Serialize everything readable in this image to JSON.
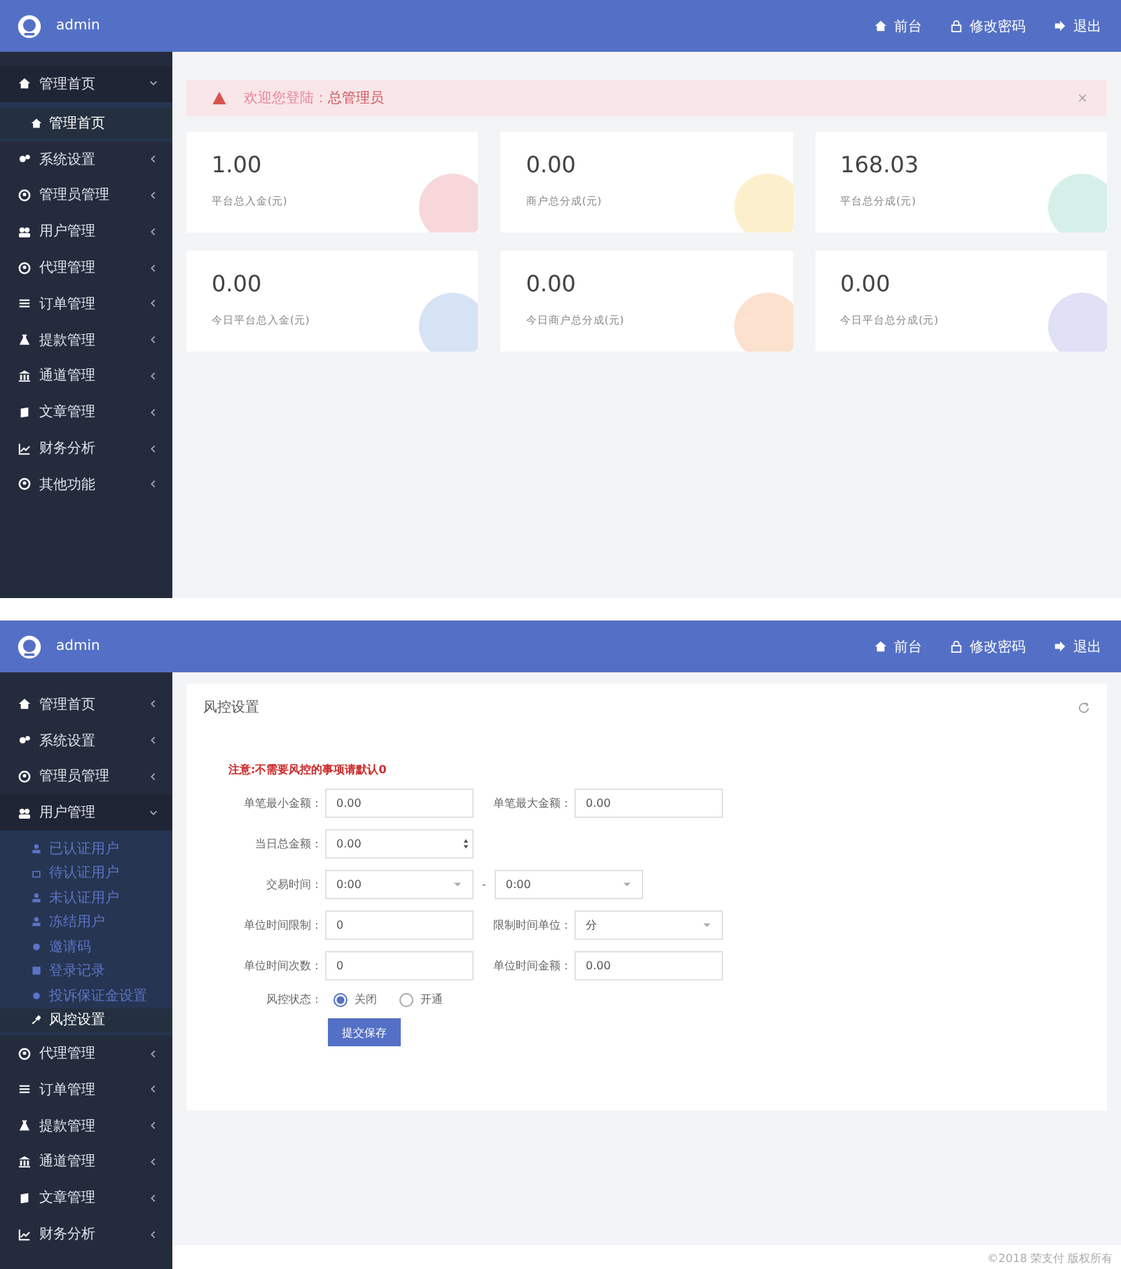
{
  "screens": [
    {
      "header": {
        "user": "admin",
        "links": [
          {
            "label": "前台"
          },
          {
            "label": "修改密码"
          },
          {
            "label": "退出"
          }
        ]
      },
      "sidebar": {
        "items": [
          {
            "label": "管理首页",
            "expanded": true,
            "children": [
              {
                "label": "管理首页",
                "selected": true
              }
            ]
          },
          {
            "label": "系统设置",
            "expanded": false
          },
          {
            "label": "管理员管理",
            "expanded": false
          },
          {
            "label": "用户管理",
            "expanded": false
          },
          {
            "label": "代理管理",
            "expanded": false
          },
          {
            "label": "订单管理",
            "expanded": false
          },
          {
            "label": "提款管理",
            "expanded": false
          },
          {
            "label": "通道管理",
            "expanded": false
          },
          {
            "label": "文章管理",
            "expanded": false
          },
          {
            "label": "财务分析",
            "expanded": false
          },
          {
            "label": "其他功能",
            "expanded": false
          }
        ]
      },
      "main": {
        "kind": "dashboard",
        "alert": {
          "text": "欢迎您登陆：",
          "role": "总管理员",
          "close": "×"
        },
        "stats": [
          {
            "value": "1.00",
            "label": "平台总入金(元)",
            "color": "#f7d7da"
          },
          {
            "value": "0.00",
            "label": "商户总分成(元)",
            "color": "#fcf0cc"
          },
          {
            "value": "168.03",
            "label": "平台总分成(元)",
            "color": "#d6f0e9"
          },
          {
            "value": "0.00",
            "label": "今日平台总入金(元)",
            "color": "#d6e3f5"
          },
          {
            "value": "0.00",
            "label": "今日商户总分成(元)",
            "color": "#fbe1ce"
          },
          {
            "value": "0.00",
            "label": "今日平台总分成(元)",
            "color": "#e0e0f6"
          }
        ]
      }
    },
    {
      "header": {
        "user": "admin",
        "links": [
          {
            "label": "前台"
          },
          {
            "label": "修改密码"
          },
          {
            "label": "退出"
          }
        ]
      },
      "sidebar": {
        "items": [
          {
            "label": "管理首页",
            "expanded": false
          },
          {
            "label": "系统设置",
            "expanded": false
          },
          {
            "label": "管理员管理",
            "expanded": false
          },
          {
            "label": "用户管理",
            "expanded": true,
            "children": [
              {
                "label": "已认证用户",
                "selected": false
              },
              {
                "label": "待认证用户",
                "selected": false
              },
              {
                "label": "未认证用户",
                "selected": false
              },
              {
                "label": "冻结用户",
                "selected": false
              },
              {
                "label": "邀请码",
                "selected": false
              },
              {
                "label": "登录记录",
                "selected": false
              },
              {
                "label": "投诉保证金设置",
                "selected": false
              },
              {
                "label": "风控设置",
                "selected": true
              }
            ]
          },
          {
            "label": "代理管理",
            "expanded": false
          },
          {
            "label": "订单管理",
            "expanded": false
          },
          {
            "label": "提款管理",
            "expanded": false
          },
          {
            "label": "通道管理",
            "expanded": false
          },
          {
            "label": "文章管理",
            "expanded": false
          },
          {
            "label": "财务分析",
            "expanded": false
          }
        ]
      },
      "main": {
        "kind": "form",
        "title": "风控设置",
        "note": "注意:不需要风控的事项请默认0",
        "rows": [
          {
            "fields": [
              {
                "label": "单笔最小金额：",
                "value": "0.00",
                "kind": "input"
              },
              {
                "label": "单笔最大金额：",
                "value": "0.00",
                "kind": "input"
              }
            ]
          },
          {
            "fields": [
              {
                "label": "当日总金额：",
                "value": "0.00",
                "kind": "number"
              }
            ]
          },
          {
            "separator": "-",
            "fields": [
              {
                "label": "交易时间：",
                "value": "0:00",
                "kind": "select"
              },
              {
                "value": "0:00",
                "kind": "select"
              }
            ]
          },
          {
            "fields": [
              {
                "label": "单位时间限制：",
                "value": "0",
                "kind": "input"
              },
              {
                "label": "限制时间单位：",
                "value": "分",
                "kind": "select"
              }
            ]
          },
          {
            "fields": [
              {
                "label": "单位时间次数：",
                "value": "0",
                "kind": "input"
              },
              {
                "label": "单位时间金额：",
                "value": "0.00",
                "kind": "input"
              }
            ]
          }
        ],
        "radio": {
          "label": "风控状态：",
          "options": [
            {
              "label": "关闭",
              "selected": true
            },
            {
              "label": "开通",
              "selected": false
            }
          ]
        },
        "submit": "提交保存"
      },
      "footer": "©2018 荣支付 版权所有"
    }
  ]
}
